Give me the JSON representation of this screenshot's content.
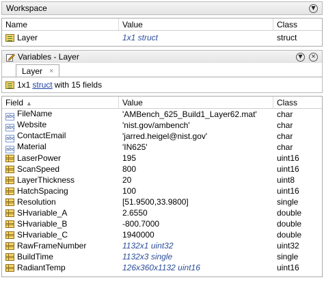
{
  "workspace": {
    "title": "Workspace",
    "columns": {
      "name": "Name",
      "value": "Value",
      "class": "Class"
    },
    "rows": [
      {
        "name": "Layer",
        "value": "1x1 struct",
        "class": "struct"
      }
    ],
    "menu_icon": "chevron-down-icon"
  },
  "variables": {
    "title": "Variables - Layer",
    "menu_icon": "chevron-down-icon",
    "close_icon": "close-icon",
    "tab": {
      "label": "Layer",
      "close": "×"
    },
    "info": {
      "prefix": "1x1",
      "link": "struct",
      "suffix": "with 15 fields"
    },
    "columns": {
      "field": "Field",
      "value": "Value",
      "class": "Class",
      "sort_indicator": "▲"
    },
    "rows": [
      {
        "icon": "char-icon",
        "field": "FileName",
        "value": "'AMBench_625_Build1_Layer62.mat'",
        "class": "char",
        "italic": false
      },
      {
        "icon": "char-icon",
        "field": "Website",
        "value": "'nist.gov/ambench'",
        "class": "char",
        "italic": false
      },
      {
        "icon": "char-icon",
        "field": "ContactEmail",
        "value": "'jarred.heigel@nist.gov'",
        "class": "char",
        "italic": false
      },
      {
        "icon": "char-icon",
        "field": "Material",
        "value": "'IN625'",
        "class": "char",
        "italic": false
      },
      {
        "icon": "matrix-icon",
        "field": "LaserPower",
        "value": "195",
        "class": "uint16",
        "italic": false
      },
      {
        "icon": "matrix-icon",
        "field": "ScanSpeed",
        "value": "800",
        "class": "uint16",
        "italic": false
      },
      {
        "icon": "matrix-icon",
        "field": "LayerThickness",
        "value": "20",
        "class": "uint8",
        "italic": false
      },
      {
        "icon": "matrix-icon",
        "field": "HatchSpacing",
        "value": "100",
        "class": "uint16",
        "italic": false
      },
      {
        "icon": "matrix-icon",
        "field": "Resolution",
        "value": "[51.9500,33.9800]",
        "class": "single",
        "italic": false
      },
      {
        "icon": "matrix-icon",
        "field": "SHvariable_A",
        "value": "2.6550",
        "class": "double",
        "italic": false
      },
      {
        "icon": "matrix-icon",
        "field": "SHvariable_B",
        "value": "-800.7000",
        "class": "double",
        "italic": false
      },
      {
        "icon": "matrix-icon",
        "field": "SHvariable_C",
        "value": "1940000",
        "class": "double",
        "italic": false
      },
      {
        "icon": "matrix-icon",
        "field": "RawFrameNumber",
        "value": "1132x1 uint32",
        "class": "uint32",
        "italic": true
      },
      {
        "icon": "matrix-icon",
        "field": "BuildTime",
        "value": "1132x3 single",
        "class": "single",
        "italic": true
      },
      {
        "icon": "matrix-icon",
        "field": "RadiantTemp",
        "value": "126x360x1132 uint16",
        "class": "uint16",
        "italic": true
      }
    ]
  },
  "colors": {
    "link": "#1a3fa8",
    "italic_value": "#2b4d9a",
    "border": "#a9a9a9"
  }
}
